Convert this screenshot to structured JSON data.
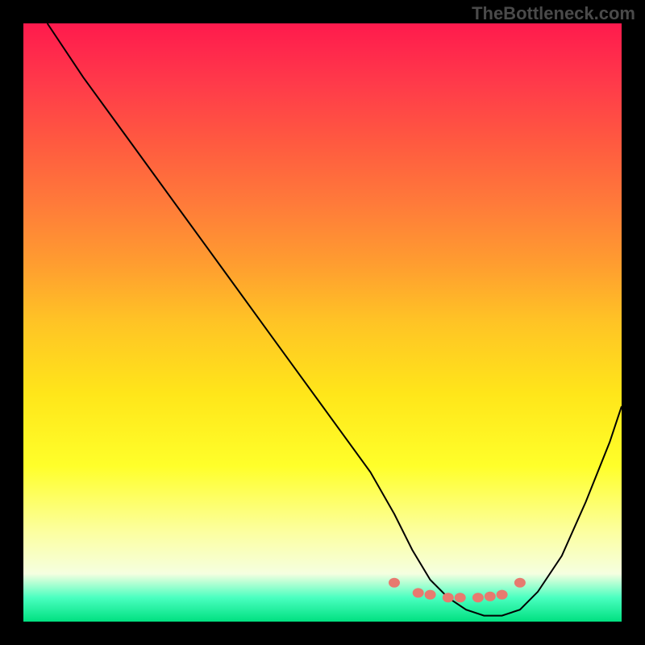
{
  "watermark": "TheBottleneck.com",
  "chart_data": {
    "type": "line",
    "title": "",
    "xlabel": "",
    "ylabel": "",
    "xlim": [
      0,
      100
    ],
    "ylim": [
      0,
      100
    ],
    "series": [
      {
        "name": "bottleneck-curve",
        "x": [
          4,
          10,
          18,
          26,
          34,
          42,
          50,
          58,
          62,
          65,
          68,
          71,
          74,
          77,
          80,
          83,
          86,
          90,
          94,
          98,
          100
        ],
        "values": [
          100,
          91,
          80,
          69,
          58,
          47,
          36,
          25,
          18,
          12,
          7,
          4,
          2,
          1,
          1,
          2,
          5,
          11,
          20,
          30,
          36
        ]
      }
    ],
    "markers": {
      "name": "highlight-points",
      "x": [
        62,
        66,
        68,
        71,
        73,
        76,
        78,
        80,
        83
      ],
      "values": [
        6.5,
        4.8,
        4.5,
        4.0,
        4.0,
        4.0,
        4.2,
        4.5,
        6.5
      ]
    },
    "background_gradient": {
      "top_color": "#ff1a4d",
      "mid_color": "#ffe61a",
      "bottom_color": "#00e080"
    }
  }
}
